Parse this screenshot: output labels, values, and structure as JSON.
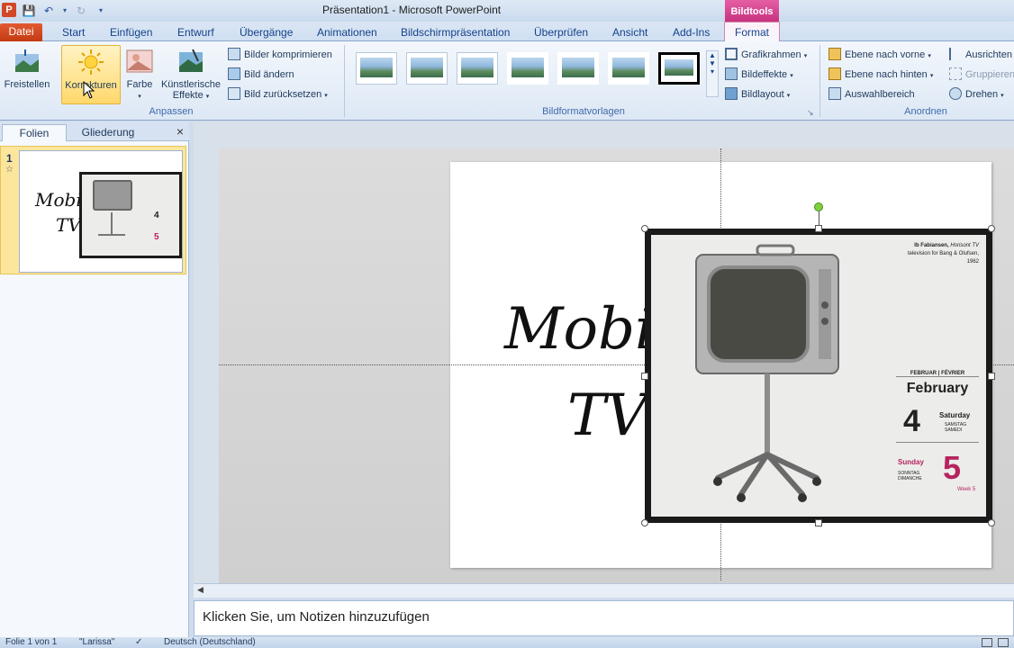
{
  "window": {
    "title": "Präsentation1  -  Microsoft PowerPoint",
    "contextual_tab": "Bildtools",
    "app_icon": "P"
  },
  "tabs": [
    {
      "label": "Datei"
    },
    {
      "label": "Start"
    },
    {
      "label": "Einfügen"
    },
    {
      "label": "Entwurf"
    },
    {
      "label": "Übergänge"
    },
    {
      "label": "Animationen"
    },
    {
      "label": "Bildschirmpräsentation"
    },
    {
      "label": "Überprüfen"
    },
    {
      "label": "Ansicht"
    },
    {
      "label": "Add-Ins"
    },
    {
      "label": "Format"
    }
  ],
  "ribbon": {
    "anpassen": {
      "label": "Anpassen",
      "freistellen": "Freistellen",
      "korrekturen": "Korrekturen",
      "farbe": "Farbe",
      "kuenstlerische_1": "Künstlerische",
      "kuenstlerische_2": "Effekte",
      "bilder_komprimieren": "Bilder komprimieren",
      "bild_aendern": "Bild ändern",
      "bild_zuruecksetzen": "Bild zurücksetzen"
    },
    "bildformatvorlagen": {
      "label": "Bildformatvorlagen",
      "grafikrahmen": "Grafikrahmen",
      "bildeffekte": "Bildeffekte",
      "bildlayout": "Bildlayout"
    },
    "anordnen": {
      "label": "Anordnen",
      "ebene_vorne": "Ebene nach vorne",
      "ebene_hinten": "Ebene nach hinten",
      "auswahlbereich": "Auswahlbereich",
      "ausrichten": "Ausrichten",
      "gruppieren": "Gruppieren",
      "drehen": "Drehen"
    }
  },
  "left_pane": {
    "tab_folien": "Folien",
    "tab_gliederung": "Gliederung",
    "close": "×",
    "slide_number": "1",
    "thumb_text_1": "Mobi",
    "thumb_text_2": "TV"
  },
  "slide": {
    "title_line1": "Mobi",
    "title_line2": "TV"
  },
  "picture": {
    "caption_name": "Ib Fabiansen,",
    "caption_title": "Horisont TV",
    "caption_sub": "television for Bang & Olufsen, 1962",
    "month_header": "FEBRUAR | FÉVRIER",
    "month": "February",
    "day1_num": "4",
    "day1_name": "Saturday",
    "day1_sub": "SAMSTAG SAMEDI",
    "day2_name": "Sunday",
    "day2_sub": "SONNTAG DIMANCHE",
    "day2_num": "5",
    "week": "Week 5"
  },
  "notes": {
    "placeholder": "Klicken Sie, um Notizen hinzuzufügen"
  },
  "statusbar": {
    "slide_info": "Folie 1 von 1",
    "theme": "\"Larissa\"",
    "language": "Deutsch (Deutschland)"
  },
  "colors": {
    "file_tab": "#c23b12",
    "contextual": "#c8327f",
    "calendar_accent": "#b5245f"
  }
}
